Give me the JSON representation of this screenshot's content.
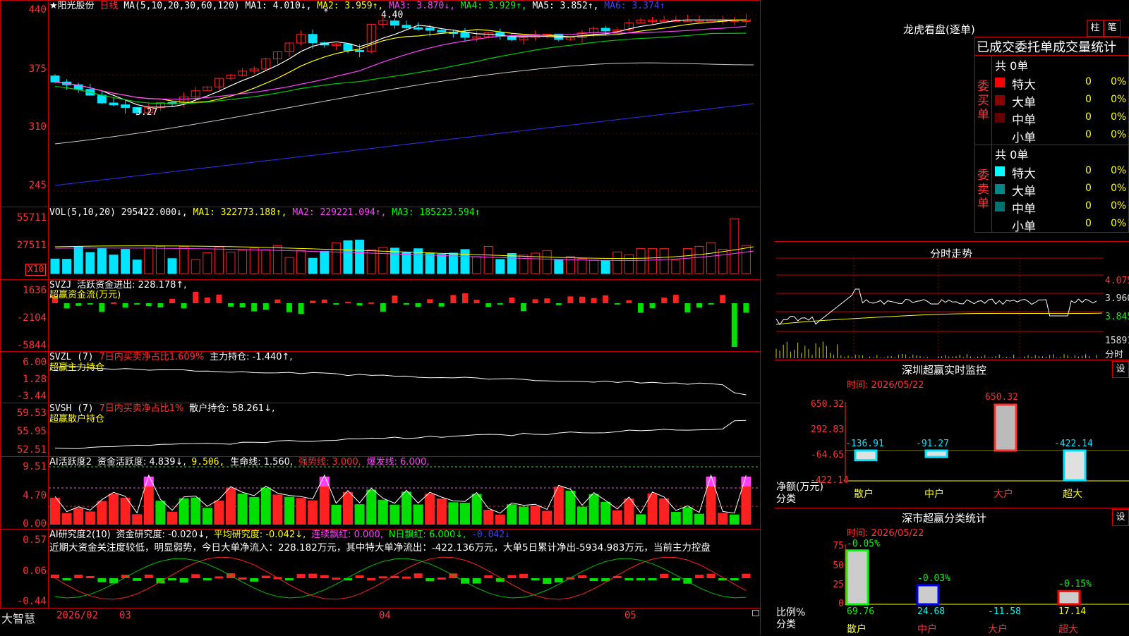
{
  "stock": {
    "star": "★",
    "name": "阳光股份",
    "period": "日线"
  },
  "ma": {
    "label": "MA(5,10,20,30,60,120)",
    "ma1": "MA1: 4.010↓,",
    "ma2": "MA2: 3.959↑,",
    "ma3": "MA3: 3.870↓,",
    "ma4": "MA4: 3.929↑,",
    "ma5": "MA5: 3.852↑,",
    "ma6": "MA6: 3.374↑"
  },
  "price_axis": [
    "440",
    "375",
    "310",
    "245"
  ],
  "price_notes": {
    "high": "4.40",
    "low": "3.27",
    "high_marker": "*"
  },
  "vol": {
    "label": "VOL(5,10,20)",
    "value": "295422.000↓,",
    "ma1": "MA1: 322773.188↑,",
    "ma2": "MA2: 229221.094↑,",
    "ma3": "MA3: 185223.594↑",
    "axis": [
      "55711",
      "27511"
    ],
    "unit": "X10"
  },
  "svzj": {
    "label": "SVZJ",
    "text": "活跃资金进出: 228.178↑,",
    "sub": "超赢资金流(万元)",
    "axis": [
      "1636",
      "-2104",
      "-5844"
    ]
  },
  "svzl": {
    "label": "SVZL (7)",
    "t1": "7日内买卖净占比1.609%",
    "t2": "主力持仓: -1.440↑,",
    "sub": "超赢主力持仓",
    "axis": [
      "6.00",
      "1.28",
      "-3.44"
    ]
  },
  "svsh": {
    "label": "SVSH (7)",
    "t1": "7日内买卖净占比1%",
    "t2": "散户持仓: 58.261↓,",
    "sub": "超赢散户持仓",
    "axis": [
      "59.53",
      "55.95",
      "52.51"
    ]
  },
  "ai2": {
    "label": "AI活跃度2",
    "t1": "资金活跃度: 4.839↓,",
    "t2": "9.506,",
    "t3": "生命线: 1.560,",
    "t4": "强势线: 3.000,",
    "t5": "爆发线: 6.000,",
    "axis": [
      "9.51",
      "4.70",
      "0.00"
    ]
  },
  "ai_res": {
    "label": "AI研究度2(10)",
    "t1": "资金研究度: -0.020↓,",
    "t2": "平均研究度: -0.042↓,",
    "t3": "连续飘红: 0.000,",
    "t4": "N日飘红: 6.000↓,",
    "t5": "-0.042↓",
    "comment": "近期大资金关注度较低，明显弱势，今日大单净流入：228.182万元，其中特大单净流出：-422.136万元，大单5日累计净出-5934.983万元，当前主力控盘",
    "axis": [
      "0.57",
      "0.06",
      "-0.44"
    ]
  },
  "bottom_bar": {
    "brand": "大智慧",
    "dates": [
      "2026/02",
      "03",
      "04",
      "05"
    ]
  },
  "longhu": {
    "title": "龙虎看盘(逐单)",
    "btn1": "柱",
    "btn2": "笔",
    "subtitle": "已成交委托单成交量统计",
    "buy": {
      "side": "委买单",
      "total": "共 0单",
      "rows": [
        {
          "name": "特大",
          "count": "0",
          "pct": "0%",
          "color": "#ff0000"
        },
        {
          "name": "大单",
          "count": "0",
          "pct": "0%",
          "color": "#8b0000"
        },
        {
          "name": "中单",
          "count": "0",
          "pct": "0%",
          "color": "#660000"
        },
        {
          "name": "小单",
          "count": "0",
          "pct": "0%",
          "color": ""
        }
      ]
    },
    "sell": {
      "side": "委卖单",
      "total": "共 0单",
      "rows": [
        {
          "name": "特大",
          "count": "0",
          "pct": "0%",
          "color": "#00ffff"
        },
        {
          "name": "大单",
          "count": "0",
          "pct": "0%",
          "color": "#008888"
        },
        {
          "name": "中单",
          "count": "0",
          "pct": "0%",
          "color": "#007070"
        },
        {
          "name": "小单",
          "count": "0",
          "pct": "0%",
          "color": ""
        }
      ]
    }
  },
  "intraday": {
    "title": "分时走势",
    "axis": [
      "4.075",
      "3.960",
      "3.845",
      "15891",
      "分时"
    ]
  },
  "sz_monitor": {
    "title": "深圳超赢实时监控",
    "btn": "设",
    "time": "时间: 2026/05/22",
    "axis": [
      "650.32",
      "292.83",
      "-64.65",
      "-422.14"
    ],
    "ylabel": "净额(万元)",
    "xlabel": "分类",
    "categories": [
      "散户",
      "中户",
      "大户",
      "超大"
    ],
    "values": [
      "-136.91",
      "-91.27",
      "650.32",
      "-422.14"
    ]
  },
  "sz_class": {
    "title": "深市超赢分类统计",
    "btn": "设",
    "time": "时间: 2026/05/22",
    "axis": [
      "75",
      "50",
      "25",
      "0"
    ],
    "ylabel": "比例%",
    "xlabel": "分类",
    "categories": [
      "散户",
      "中户",
      "大户",
      "超大"
    ],
    "top_labels": [
      "-0.05%",
      "-0.03%",
      "",
      "-0.15%"
    ],
    "bottom_values": [
      "69.76",
      "24.68",
      "-11.58",
      "17.14"
    ]
  }
}
